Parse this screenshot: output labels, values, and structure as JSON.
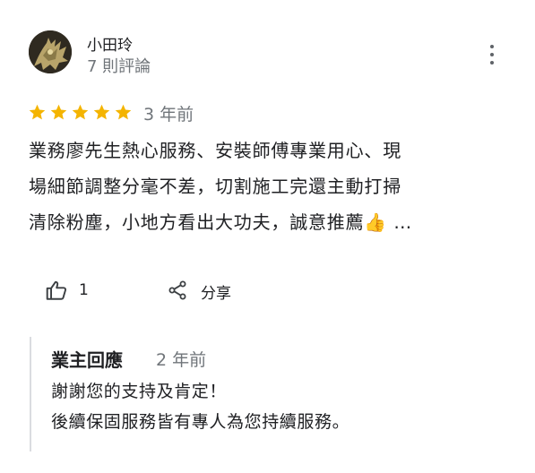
{
  "reviewer": {
    "name": "小田玲",
    "review_count": "7 則評論"
  },
  "rating": {
    "stars": 5,
    "max": 5,
    "color": "#f4b400"
  },
  "posted_ago": "3 年前",
  "review_lines": [
    "業務廖先生熱心服務、安裝師傅專業用心、現",
    "場細節調整分毫不差，切割施工完還主動打掃",
    "清除粉塵，小地方看出大功夫，誠意推薦👍 …"
  ],
  "actions": {
    "like_count": "1",
    "share_label": "分享"
  },
  "owner_reply": {
    "title": "業主回應",
    "ago": "2 年前",
    "lines": [
      "謝謝您的支持及肯定！",
      "後續保固服務皆有專人為您持續服務。"
    ]
  },
  "icons": [
    "avatar",
    "more-vert-icon",
    "star-icon",
    "thumb-up-icon",
    "share-icon"
  ]
}
